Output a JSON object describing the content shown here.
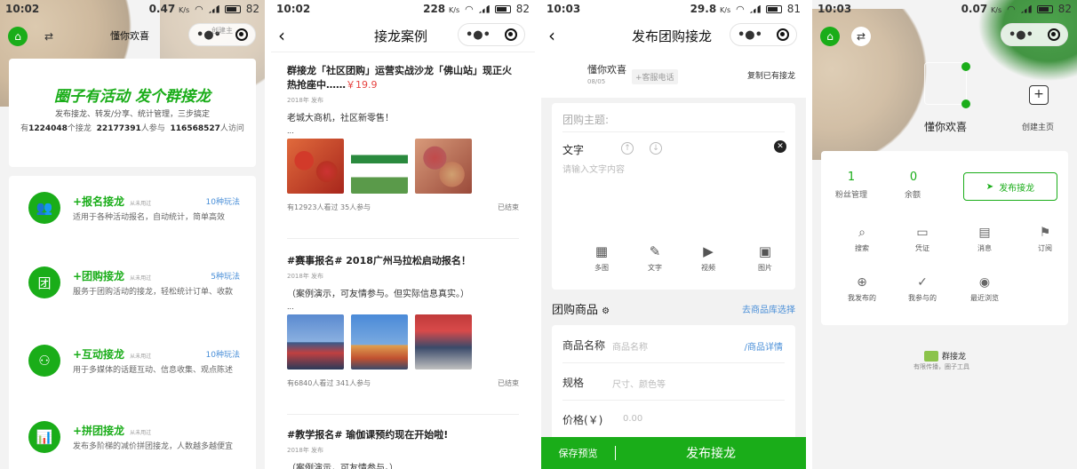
{
  "p1": {
    "time": "10:02",
    "net": "0.47",
    "net_unit": "K/s",
    "battery": "82",
    "nav_title": "懂你欢喜",
    "overlay": "创建主",
    "banner": {
      "title": "圈子有活动 发个群接龙",
      "subtitle": "发布接龙、转发/分享、统计管理，三步搞定",
      "stat_prefix": "有",
      "n1": "1224048",
      "s1": "个接龙",
      "n2": "22177391",
      "s2": "人参与",
      "n3": "116568527",
      "s3": "人访问"
    },
    "features": [
      {
        "name": "+报名接龙",
        "tag": "从未用过",
        "plays": "10种玩法",
        "desc": "适用于各种活动报名，自动统计，简单高效",
        "icon": "people-icon"
      },
      {
        "name": "+团购接龙",
        "tag": "从未用过",
        "plays": "5种玩法",
        "desc": "服务于团购活动的接龙，轻松统计订单、收款",
        "icon": "tuan-icon"
      },
      {
        "name": "+互动接龙",
        "tag": "从未用过",
        "plays": "10种玩法",
        "desc": "用于多媒体的话题互动、信息收集、观点陈述",
        "icon": "interact-icon"
      },
      {
        "name": "+拼团接龙",
        "tag": "从未用过",
        "plays": "",
        "desc": "发布多阶梯的减价拼团接龙，人数越多越便宜",
        "icon": "chart-icon"
      }
    ]
  },
  "p2": {
    "time": "10:02",
    "net": "228",
    "net_unit": "K/s",
    "battery": "82",
    "nav_title": "接龙案例",
    "cases": [
      {
        "title": "群接龙「社区团购」运营实战沙龙「佛山站」现正火热抢座中……",
        "price": "￥19.9",
        "year": "2018年 发布",
        "text": "老城大商机，社区新零售！",
        "ellipsis": "...",
        "stats": "有12923人看过 35人参与",
        "status": "已结束"
      },
      {
        "title": "#赛事报名# 2018广州马拉松启动报名！",
        "price": "",
        "year": "2018年 发布",
        "text": "（案例演示，可友情参与。但实际信息真实。）",
        "ellipsis": "...",
        "stats": "有6840人看过 341人参与",
        "status": "已结束"
      },
      {
        "title": "#教学报名# 瑜伽课预约现在开始啦!",
        "price": "",
        "year": "2018年 发布",
        "text": "（案例演示，可友情参与。）",
        "ellipsis": "",
        "stats": "",
        "status": ""
      }
    ]
  },
  "p3": {
    "time": "10:03",
    "net": "29.8",
    "net_unit": "K/s",
    "battery": "81",
    "nav_title": "发布团购接龙",
    "user": "懂你欢喜",
    "date": "08/05",
    "service": "+客服电话",
    "copy_link": "复制已有接龙",
    "topic_placeholder": "团购主题:",
    "text_label": "文字",
    "text_placeholder": "请输入文字内容",
    "tools": [
      {
        "label": "多图",
        "icon": "grid-icon"
      },
      {
        "label": "文字",
        "icon": "edit-icon"
      },
      {
        "label": "视频",
        "icon": "play-icon"
      },
      {
        "label": "图片",
        "icon": "image-icon"
      }
    ],
    "goods_title": "团购商品",
    "goods_link": "去商品库选择",
    "fields": [
      {
        "label": "商品名称",
        "placeholder": "商品名称",
        "extra": "/商品详情"
      },
      {
        "label": "规格",
        "placeholder": "尺寸、颜色等",
        "extra": ""
      },
      {
        "label": "价格(￥)",
        "placeholder": "0.00",
        "extra": ""
      }
    ],
    "save": "保存预览",
    "publish": "发布接龙"
  },
  "p4": {
    "time": "10:03",
    "net": "0.07",
    "net_unit": "K/s",
    "battery": "82",
    "user": "懂你欢喜",
    "create": "创建主页",
    "stat1_num": "1",
    "stat1_label": "粉丝管理",
    "stat2_num": "0",
    "stat2_label": "余额",
    "publish_btn": "发布接龙",
    "menu": [
      {
        "label": "搜索",
        "icon": "search-icon"
      },
      {
        "label": "凭证",
        "icon": "ticket-icon"
      },
      {
        "label": "消息",
        "icon": "message-icon"
      },
      {
        "label": "订阅",
        "icon": "bookmark-icon"
      },
      {
        "label": "我发布的",
        "icon": "plus-circle-icon"
      },
      {
        "label": "我参与的",
        "icon": "check-circle-icon"
      },
      {
        "label": "最近浏览",
        "icon": "eye-icon"
      }
    ],
    "brand": "群接龙",
    "tagline": "有限传播，圈子工具"
  },
  "colors": {
    "accent": "#1aad19",
    "link": "#4a8fd8",
    "price": "#e64340"
  }
}
